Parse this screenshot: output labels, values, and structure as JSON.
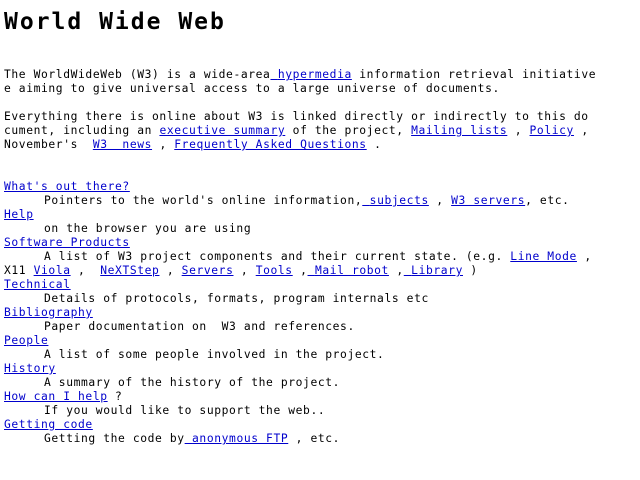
{
  "title": "World Wide Web",
  "intro": {
    "p1_a": "The WorldWideWeb (W3) is a wide-area",
    "p1_link": "hypermedia",
    "p1_b": " information retrieval initiative",
    "p1_c": "e aiming to give universal access to a large universe of documents.",
    "p2_a": "Everything there is online about W3 is linked directly or indirectly to this do",
    "p2_b": "cument, including an ",
    "p2_link_summary": "executive summary",
    "p2_c": " of the project, ",
    "p2_link_mailing": "Mailing lists",
    "p2_d": " , ",
    "p2_link_policy": "Policy",
    "p2_e": " ,",
    "p2_f": "November's  ",
    "p2_link_news": "W3  news",
    "p2_g": " , ",
    "p2_link_faq": "Frequently Asked Questions",
    "p2_h": " ."
  },
  "sections": {
    "whats_out_there": {
      "term": "What's out there?",
      "desc_a": "Pointers to the world's online information,",
      "link_subjects": "subjects",
      "desc_b": " , ",
      "link_servers": "W3 servers",
      "desc_c": ", etc."
    },
    "help": {
      "term": "Help",
      "desc": "on the browser you are using"
    },
    "software": {
      "term": "Software Products",
      "desc_a": "A list of W3 project components and their current state. (e.g. ",
      "link_line_mode": "Line Mode",
      "desc_b": " ,",
      "desc_c": "X11 ",
      "link_viola": "Viola",
      "desc_d": " ,  ",
      "link_nextstep": "NeXTStep",
      "desc_e": " , ",
      "link_servers": "Servers",
      "desc_f": " , ",
      "link_tools": "Tools",
      "desc_g": " ,",
      "link_mail_robot": "Mail robot",
      "desc_h": " ,",
      "link_library": "Library",
      "desc_i": " )"
    },
    "technical": {
      "term": "Technical",
      "desc": "Details of protocols, formats, program internals etc"
    },
    "bibliography": {
      "term": "Bibliography",
      "desc": "Paper documentation on  W3 and references."
    },
    "people": {
      "term": "People",
      "desc": "A list of some people involved in the project."
    },
    "history": {
      "term": "History",
      "desc": "A summary of the history of the project."
    },
    "how_can_i_help": {
      "term": "How can I help",
      "suffix": " ?",
      "desc": "If you would like to support the web.."
    },
    "getting_code": {
      "term": "Getting code",
      "desc_a": "Getting the code by",
      "link_ftp": "anonymous FTP",
      "desc_b": " , etc."
    }
  },
  "colors": {
    "background": "#ffffff",
    "text": "#000000",
    "link": "#0000cc"
  }
}
